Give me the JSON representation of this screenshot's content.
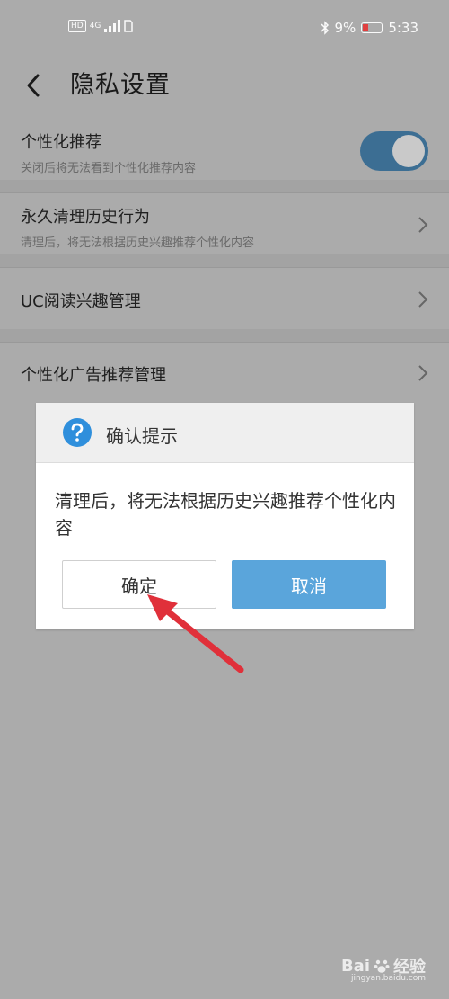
{
  "status_bar": {
    "left_badge": "HD",
    "network": "4G",
    "battery_percent": "9%",
    "time": "5:33"
  },
  "header": {
    "title": "隐私设置"
  },
  "settings": [
    {
      "title": "个性化推荐",
      "subtitle": "关闭后将无法看到个性化推荐内容",
      "control": "toggle",
      "toggle_on": true
    },
    {
      "title": "永久清理历史行为",
      "subtitle": "清理后，将无法根据历史兴趣推荐个性化内容",
      "control": "chevron"
    },
    {
      "title": "UC阅读兴趣管理",
      "control": "chevron"
    },
    {
      "title": "个性化广告推荐管理",
      "control": "chevron"
    }
  ],
  "dialog": {
    "title": "确认提示",
    "message": "清理后，将无法根据历史兴趣推荐个性化内容",
    "confirm_label": "确定",
    "cancel_label": "取消",
    "icon": "help-circle-icon"
  },
  "watermark": {
    "brand": "Bai",
    "brand_suffix": "经验",
    "url": "jingyan.baidu.com"
  },
  "colors": {
    "overlay": "#ababab",
    "toggle_track": "#3c6e93",
    "cancel_button": "#5aa5db",
    "annotation_arrow": "#e0303a",
    "help_icon": "#2f8fdc"
  }
}
